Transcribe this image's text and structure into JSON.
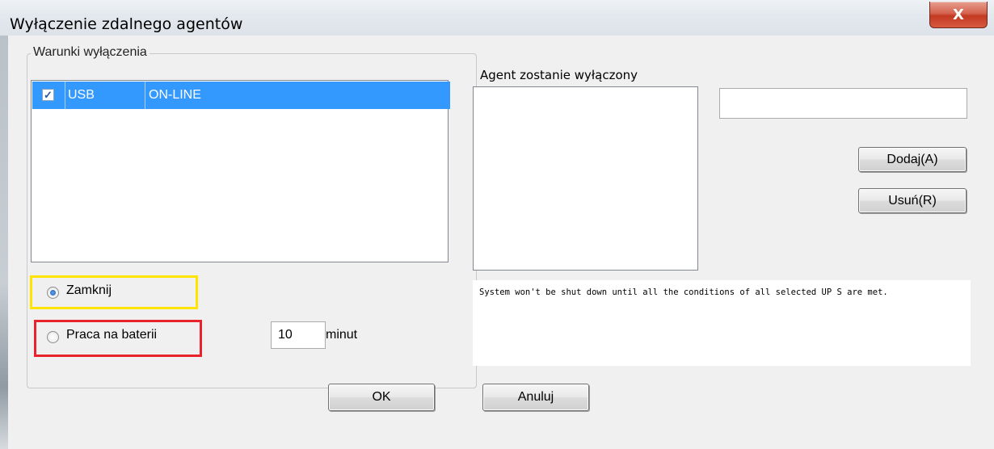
{
  "window": {
    "title": "Wyłączenie zdalnego agentów",
    "close_glyph": "X",
    "close_icon": "close-icon"
  },
  "conditions": {
    "label": "Warunki wyłączenia",
    "rows": [
      {
        "checked": true,
        "checkmark": "✓",
        "port": "USB",
        "status": "ON-LINE"
      }
    ],
    "options": {
      "shutdown_label": "Zamknij",
      "shutdown_selected": true,
      "battery_label": "Praca na baterii",
      "battery_selected": false,
      "battery_minutes": "10",
      "minutes_unit": "minut"
    }
  },
  "agents": {
    "label": "Agent zostanie wyłączony",
    "add_button": "Dodaj(A)",
    "remove_button": "Usuń(R)",
    "input_value": ""
  },
  "info_text": "System won't be shut down until all the conditions of all selected UP S are met.",
  "footer": {
    "ok_button": "OK",
    "cancel_button": "Anuluj"
  },
  "colors": {
    "selection": "#3399ff",
    "highlight_yellow": "#ffe400",
    "highlight_red": "#e8232c",
    "close_red": "#c23a22"
  }
}
